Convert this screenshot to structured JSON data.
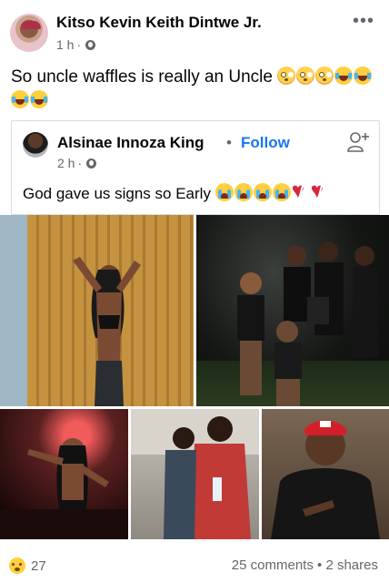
{
  "post": {
    "author": "Kitso Kevin Keith Dintwe Jr.",
    "time": "1 h",
    "meta_sep": "·",
    "audience_icon": "globe-icon",
    "more_icon": "more-options-icon",
    "text": "So uncle waffles is really an Uncle",
    "text_emojis": [
      "flushed-face",
      "flushed-face",
      "flushed-face",
      "tears-of-joy",
      "tears-of-joy",
      "tears-of-joy",
      "tears-of-joy"
    ]
  },
  "shared": {
    "author": "Alsinae Innoza King",
    "dot": "•",
    "follow_label": "Follow",
    "follow_color": "#1877f2",
    "add_friend_icon": "add-friend-icon",
    "time": "2 h",
    "meta_sep": "·",
    "audience_icon": "globe-icon",
    "text": "God gave us signs so Early",
    "text_emojis": [
      "loudly-crying",
      "loudly-crying",
      "loudly-crying",
      "loudly-crying",
      "broken-heart",
      "broken-heart"
    ]
  },
  "photos": [
    "photo-1",
    "photo-2",
    "photo-3",
    "photo-4",
    "photo-5"
  ],
  "footer": {
    "reaction_icon": "haha-reaction-icon",
    "reaction_count": "27",
    "comments": "25 comments",
    "dot": "•",
    "shares": "2 shares"
  }
}
